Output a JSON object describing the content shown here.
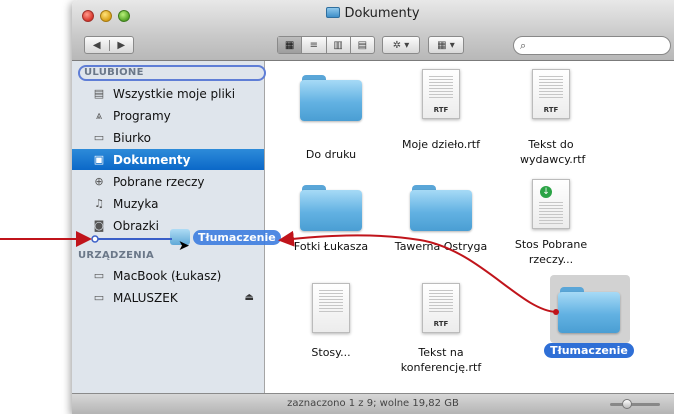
{
  "window": {
    "title": "Dokumenty"
  },
  "toolbar": {
    "nav_back": "◀",
    "nav_forward": "▶",
    "view_icons": "▦",
    "view_list": "≡",
    "view_columns": "▥",
    "view_coverflow": "▤",
    "action_label": "✲ ▾",
    "arrange_label": "▦ ▾",
    "search_glyph": "⌕"
  },
  "sidebar": {
    "favorites_header": "ULUBIONE",
    "devices_header": "URZĄDZENIA",
    "favorites": [
      {
        "label": "Wszystkie moje pliki",
        "icon": "all-files-icon"
      },
      {
        "label": "Programy",
        "icon": "applications-icon"
      },
      {
        "label": "Biurko",
        "icon": "desktop-icon"
      },
      {
        "label": "Dokumenty",
        "icon": "documents-icon",
        "selected": true
      },
      {
        "label": "Pobrane rzeczy",
        "icon": "downloads-icon"
      },
      {
        "label": "Muzyka",
        "icon": "music-icon"
      },
      {
        "label": "Obrazki",
        "icon": "pictures-icon"
      }
    ],
    "devices": [
      {
        "label": "MacBook (Łukasz)",
        "icon": "laptop-icon"
      },
      {
        "label": "MALUSZEK",
        "icon": "drive-icon",
        "eject": "⏏"
      }
    ]
  },
  "files": [
    {
      "name": "Do druku",
      "kind": "folder"
    },
    {
      "name": "Moje dzieło.rtf",
      "kind": "rtf",
      "badge": "RTF"
    },
    {
      "name": "Tekst do wydawcy.rtf",
      "kind": "rtf",
      "badge": "RTF"
    },
    {
      "name": "Fotki Łukasza",
      "kind": "folder"
    },
    {
      "name": "Tawerna Ostryga",
      "kind": "folder"
    },
    {
      "name": "Stos Pobrane rzeczy...",
      "kind": "stack"
    },
    {
      "name": "Stosy...",
      "kind": "stack"
    },
    {
      "name": "Tekst na konferencję.rtf",
      "kind": "rtf",
      "badge": "RTF"
    },
    {
      "name": "Tłumaczenie",
      "kind": "folder",
      "selected": true
    }
  ],
  "drag": {
    "label": "Tłumaczenie"
  },
  "status": {
    "text": "zaznaczono 1 z 9; wolne 19,82 GB"
  },
  "colors": {
    "selection": "#0b68c8",
    "annotation_arrow": "#c0141b",
    "insertion_line": "#3a5fc8"
  }
}
